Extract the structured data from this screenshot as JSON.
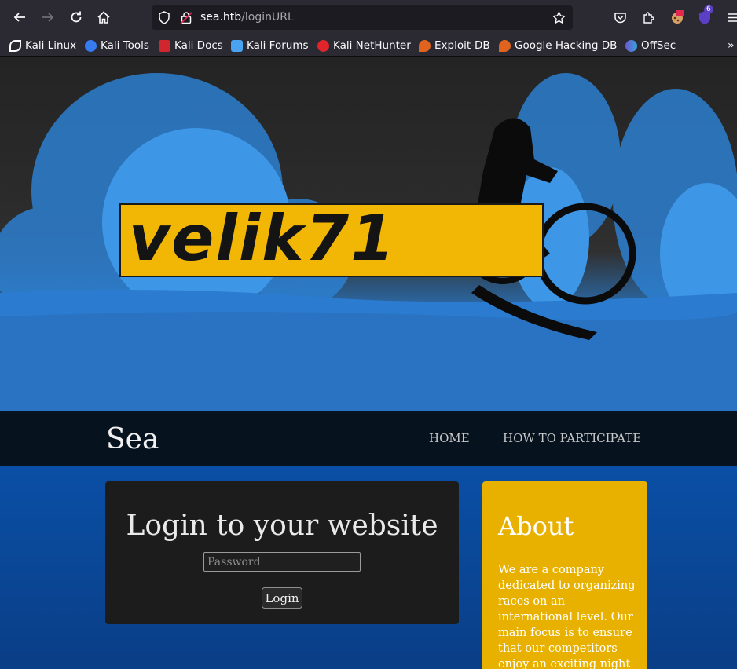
{
  "browser": {
    "url_host": "sea.htb",
    "url_path": "/loginURL",
    "extension_badge": "6",
    "bookmarks": [
      {
        "label": "Kali Linux"
      },
      {
        "label": "Kali Tools"
      },
      {
        "label": "Kali Docs"
      },
      {
        "label": "Kali Forums"
      },
      {
        "label": "Kali NetHunter"
      },
      {
        "label": "Exploit-DB"
      },
      {
        "label": "Google Hacking DB"
      },
      {
        "label": "OffSec"
      }
    ]
  },
  "hero": {
    "logo_text": "velik71"
  },
  "nav": {
    "brand": "Sea",
    "links": [
      "HOME",
      "HOW TO PARTICIPATE"
    ]
  },
  "login": {
    "title": "Login to your website",
    "password_placeholder": "Password",
    "button": "Login"
  },
  "about": {
    "title": "About",
    "text": "We are a company dedicated to organizing races on an international level. Our main focus is to ensure that our competitors enjoy an exciting night"
  },
  "colors": {
    "about_bg": "#e8b100",
    "nav_bg": "#06121e",
    "page_blue": "#0a4fa6"
  }
}
